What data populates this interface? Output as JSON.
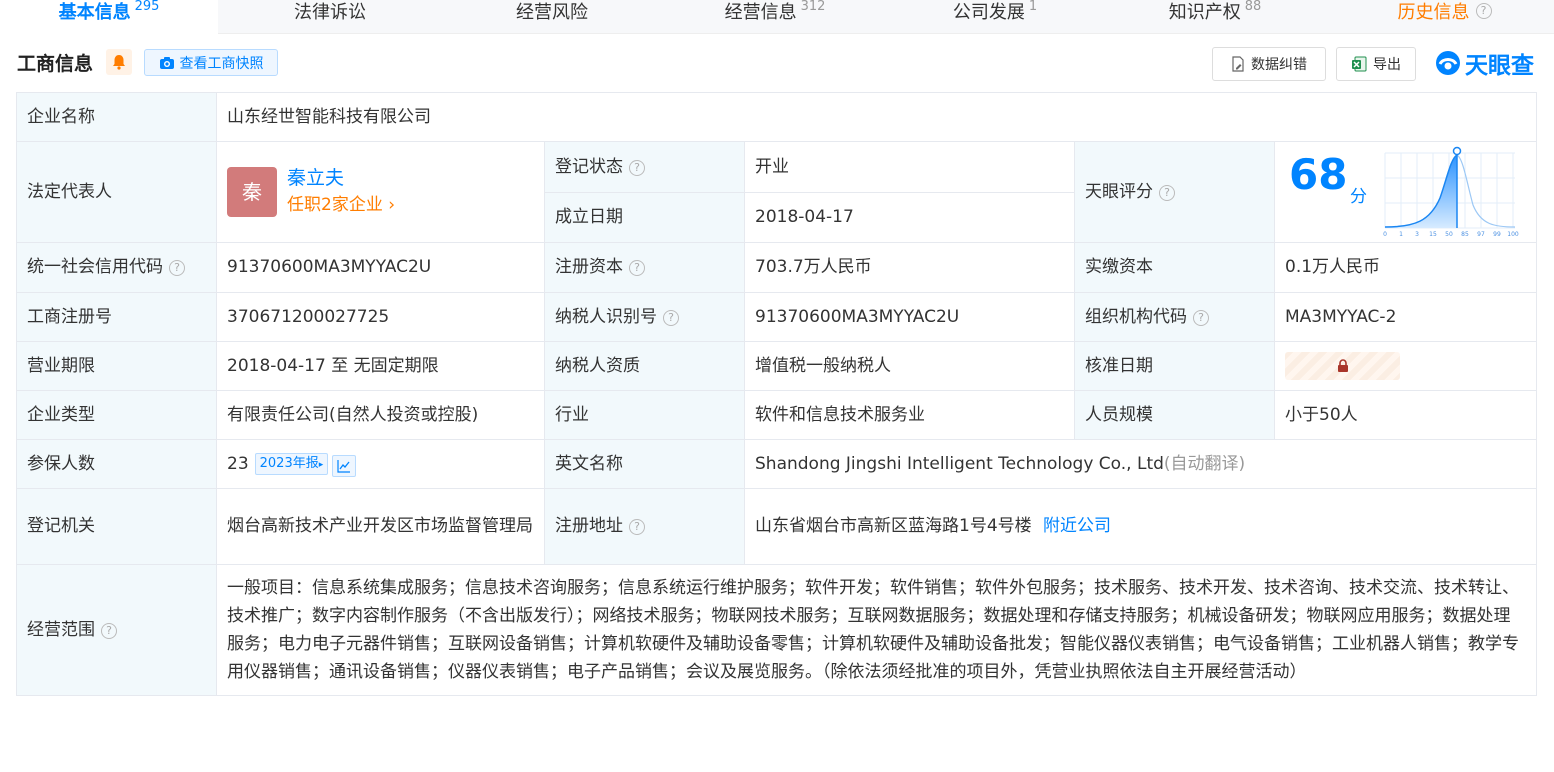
{
  "tabs": [
    {
      "label": "基本信息",
      "count": "295",
      "active": true
    },
    {
      "label": "法律诉讼",
      "count": ""
    },
    {
      "label": "经营风险",
      "count": ""
    },
    {
      "label": "经营信息",
      "count": "312"
    },
    {
      "label": "公司发展",
      "count": "1"
    },
    {
      "label": "知识产权",
      "count": "88"
    },
    {
      "label": "历史信息",
      "count": ""
    }
  ],
  "header": {
    "title": "工商信息",
    "snapshot_btn": "查看工商快照",
    "correct_btn": "数据纠错",
    "export_btn": "导出",
    "logo_text": "天眼查"
  },
  "colors": {
    "accent": "#0084ff",
    "orange": "#ff7d00",
    "green": "#27a43a",
    "label_bg": "#f2f9fc"
  },
  "info": {
    "company_name_label": "企业名称",
    "company_name": "山东经世智能科技有限公司",
    "legal_rep_label": "法定代表人",
    "legal_rep_avatar": "秦",
    "legal_rep_name": "秦立夫",
    "legal_rep_jobs": "任职2家企业",
    "reg_status_label": "登记状态",
    "reg_status": "开业",
    "found_date_label": "成立日期",
    "found_date": "2018-04-17",
    "score_label": "天眼评分",
    "score": "68",
    "score_unit": "分",
    "score_ticks": [
      "0",
      "1",
      "3",
      "15",
      "50",
      "85",
      "97",
      "99",
      "100"
    ],
    "credit_code_label": "统一社会信用代码",
    "credit_code": "91370600MA3MYYAC2U",
    "reg_capital_label": "注册资本",
    "reg_capital": "703.7万人民币",
    "paid_capital_label": "实缴资本",
    "paid_capital": "0.1万人民币",
    "reg_no_label": "工商注册号",
    "reg_no": "370671200027725",
    "taxpayer_id_label": "纳税人识别号",
    "taxpayer_id": "91370600MA3MYYAC2U",
    "org_code_label": "组织机构代码",
    "org_code": "MA3MYYAC-2",
    "term_label": "营业期限",
    "term": "2018-04-17 至 无固定期限",
    "taxpayer_qual_label": "纳税人资质",
    "taxpayer_qual": "增值税一般纳税人",
    "approve_date_label": "核准日期",
    "type_label": "企业类型",
    "type": "有限责任公司(自然人投资或控股)",
    "industry_label": "行业",
    "industry": "软件和信息技术服务业",
    "staff_label": "人员规模",
    "staff": "小于50人",
    "insured_label": "参保人数",
    "insured": "23",
    "insured_report": "2023年报",
    "english_name_label": "英文名称",
    "english_name": "Shandong Jingshi Intelligent Technology Co., Ltd",
    "auto_translate": "(自动翻译)",
    "authority_label": "登记机关",
    "authority": "烟台高新技术产业开发区市场监督管理局",
    "address_label": "注册地址",
    "address": "山东省烟台市高新区蓝海路1号4号楼",
    "nearby": "附近公司",
    "scope_label": "经营范围",
    "scope": "一般项目：信息系统集成服务；信息技术咨询服务；信息系统运行维护服务；软件开发；软件销售；软件外包服务；技术服务、技术开发、技术咨询、技术交流、技术转让、技术推广；数字内容制作服务（不含出版发行）；网络技术服务；物联网技术服务；互联网数据服务；数据处理和存储支持服务；机械设备研发；物联网应用服务；数据处理服务；电力电子元器件销售；互联网设备销售；计算机软硬件及辅助设备零售；计算机软硬件及辅助设备批发；智能仪器仪表销售；电气设备销售；工业机器人销售；教学专用仪器销售；通讯设备销售；仪器仪表销售；电子产品销售；会议及展览服务。（除依法须经批准的项目外，凭营业执照依法自主开展经营活动）"
  }
}
